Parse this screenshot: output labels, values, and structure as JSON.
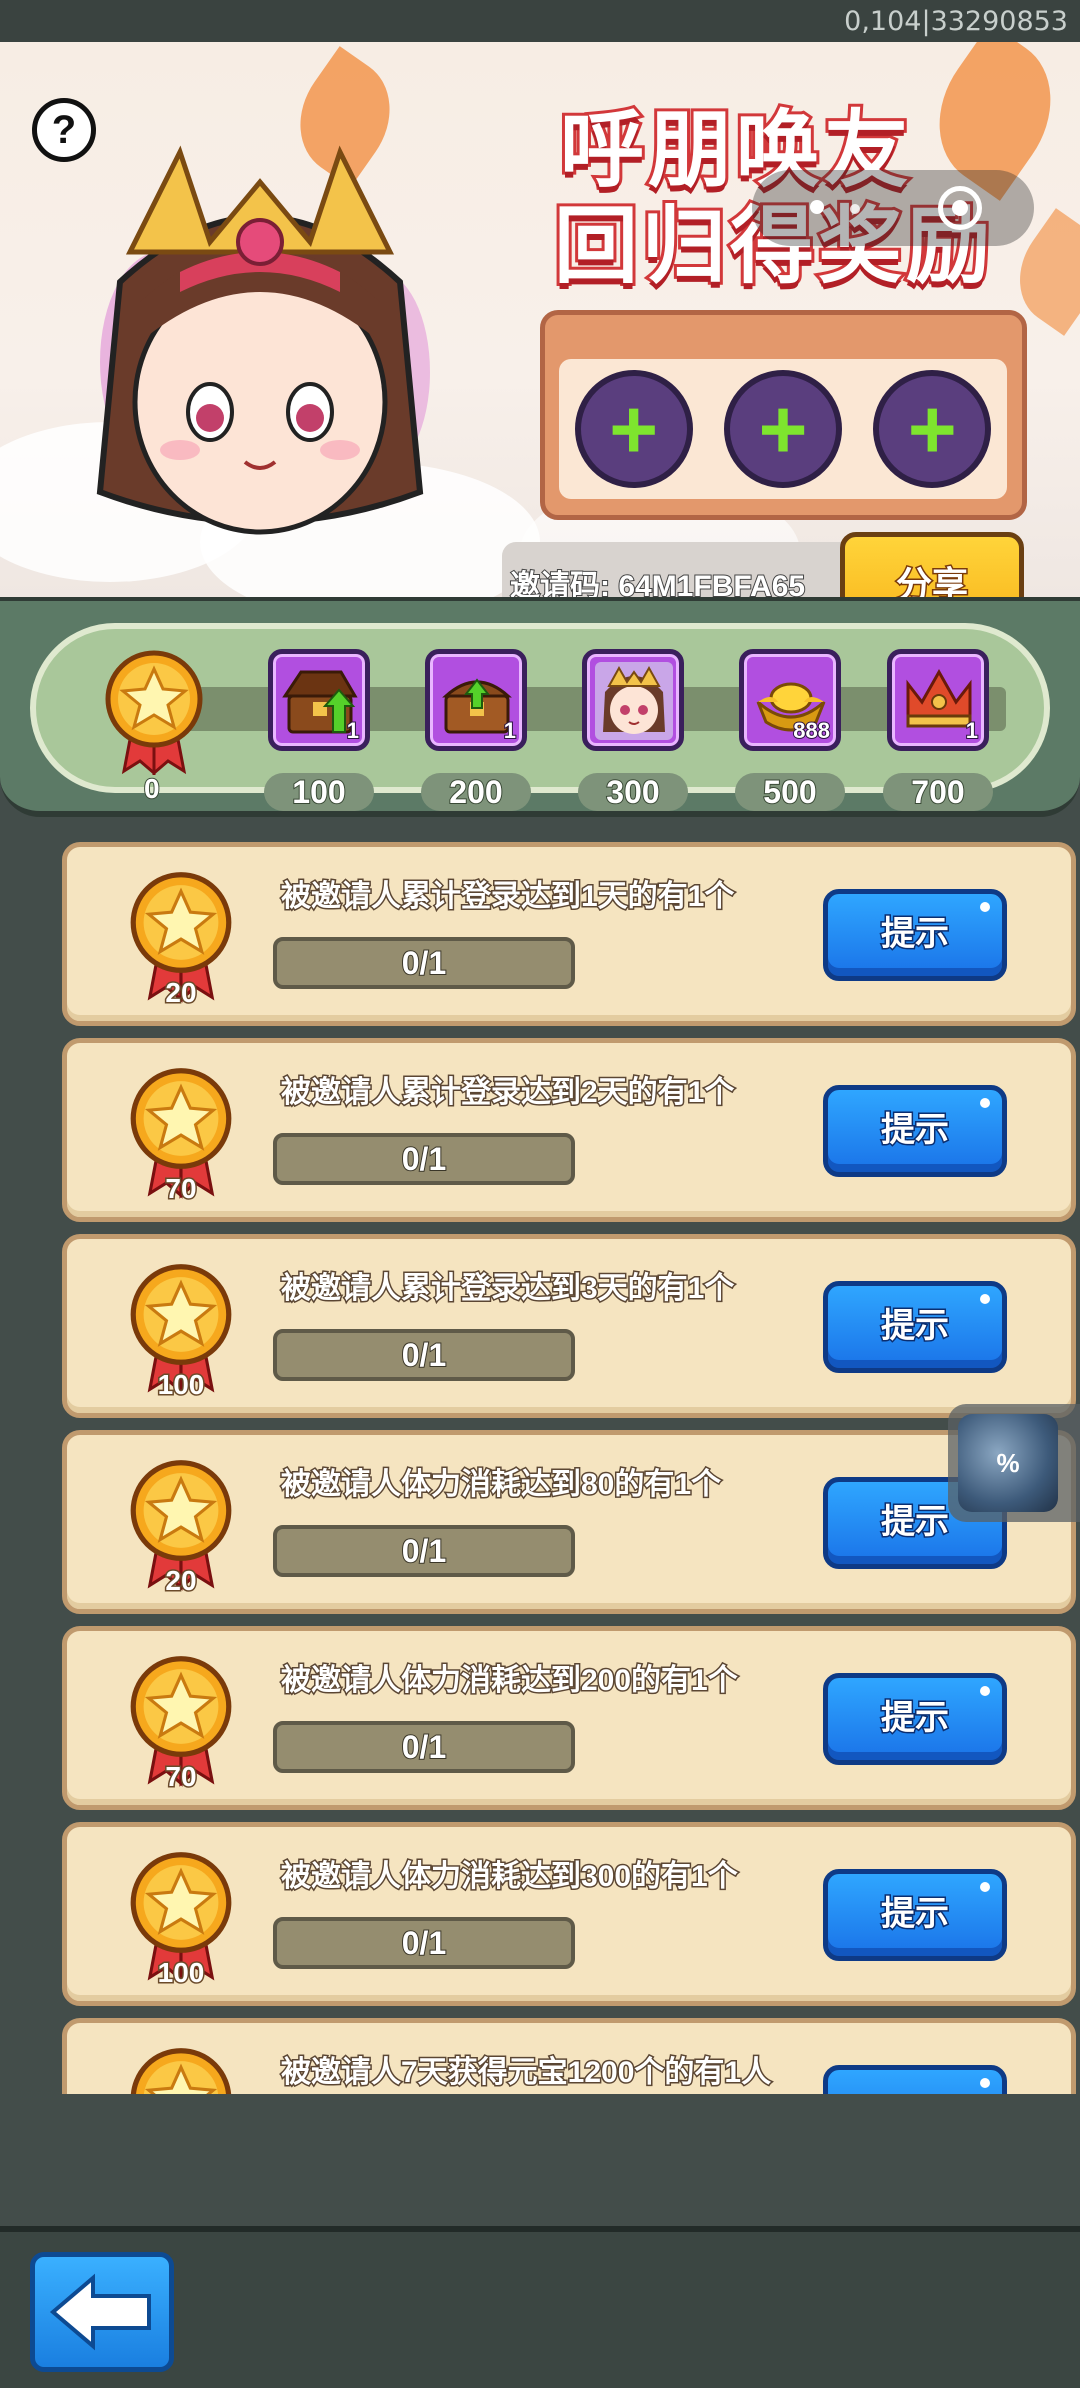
{
  "status": {
    "debug_text": "0,104|33290853"
  },
  "banner": {
    "title_line1": "呼朋唤友",
    "title_line2": "回归得奖励",
    "invite_code_label": "邀请码: 64M1FBFA65",
    "share_label": "分享",
    "help_label": "?",
    "friend_slots": [
      "+",
      "+",
      "+"
    ]
  },
  "progress": {
    "start_value": "0",
    "milestones": [
      {
        "label": "100",
        "qty": "1",
        "icon": "treasure-chest-open-icon"
      },
      {
        "label": "200",
        "qty": "1",
        "icon": "treasure-chest-closed-icon"
      },
      {
        "label": "300",
        "qty": "",
        "icon": "character-portrait-icon"
      },
      {
        "label": "500",
        "qty": "888",
        "icon": "gold-ingot-icon"
      },
      {
        "label": "700",
        "qty": "1",
        "icon": "crown-icon"
      }
    ]
  },
  "tasks": [
    {
      "title": "被邀请人累计登录达到1天的有1个",
      "reward": "20",
      "progress": "0/1",
      "button": "提示"
    },
    {
      "title": "被邀请人累计登录达到2天的有1个",
      "reward": "70",
      "progress": "0/1",
      "button": "提示"
    },
    {
      "title": "被邀请人累计登录达到3天的有1个",
      "reward": "100",
      "progress": "0/1",
      "button": "提示"
    },
    {
      "title": "被邀请人体力消耗达到80的有1个",
      "reward": "20",
      "progress": "0/1",
      "button": "提示"
    },
    {
      "title": "被邀请人体力消耗达到200的有1个",
      "reward": "70",
      "progress": "0/1",
      "button": "提示"
    },
    {
      "title": "被邀请人体力消耗达到300的有1个",
      "reward": "100",
      "progress": "0/1",
      "button": "提示"
    },
    {
      "title": "被邀请人7天获得元宝1200个的有1人",
      "reward": "",
      "progress": "",
      "button": ""
    }
  ],
  "float_widget": {
    "label": "%"
  },
  "colors": {
    "accent_blue": "#1a73e8",
    "accent_yellow": "#f8b61c",
    "panel_green": "#5c7a66"
  }
}
